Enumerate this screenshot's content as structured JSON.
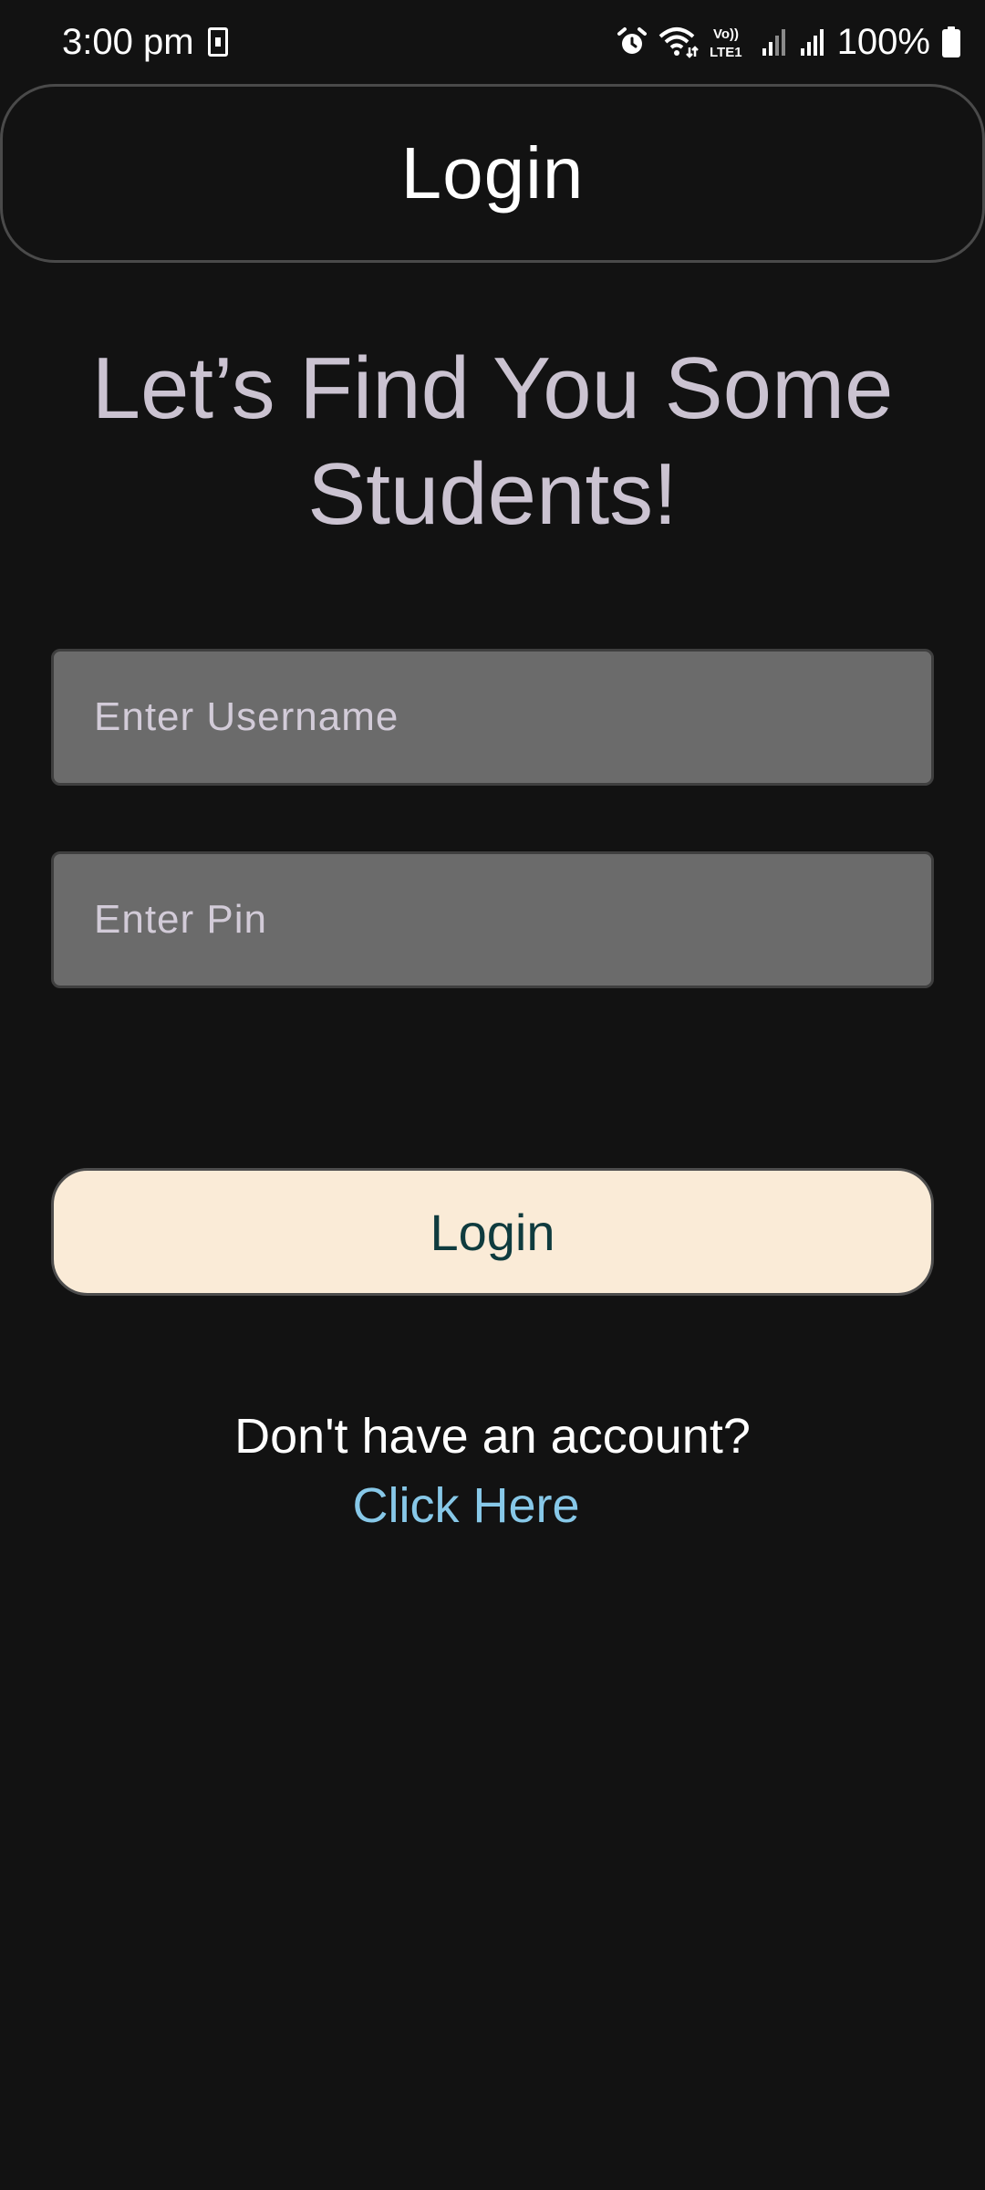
{
  "status_bar": {
    "time": "3:00 pm",
    "battery": "100%",
    "icons": [
      "sim-card-icon",
      "alarm-icon",
      "wifi-icon",
      "volte-icon",
      "signal-icon",
      "signal-icon",
      "battery-icon"
    ],
    "volte_label_top": "Vo))",
    "volte_label_bottom": "LTE1"
  },
  "app_bar": {
    "title": "Login"
  },
  "main": {
    "heading": "Let’s Find You Some Students!",
    "username_placeholder": "Enter Username",
    "username_value": "",
    "pin_placeholder": "Enter Pin",
    "pin_value": "",
    "login_label": "Login",
    "account_prompt": "Don't have an account?",
    "click_here": "Click Here"
  },
  "colors": {
    "background": "#121212",
    "heading": "#cbc3d1",
    "input_fill": "#6b6b6b",
    "button_fill": "#faebd7",
    "button_text": "#0f3b3e",
    "link": "#87c8e8"
  }
}
